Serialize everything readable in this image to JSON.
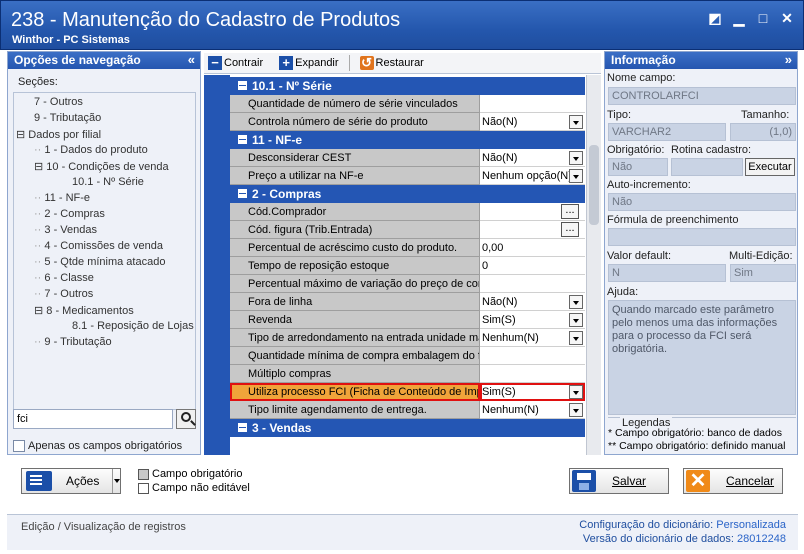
{
  "window": {
    "title": "238 - Manutenção do Cadastro de Produtos",
    "subtitle": "Winthor - PC Sistemas"
  },
  "nav": {
    "header": "Opções de navegação",
    "sections_label": "Seções:",
    "tree": [
      "7 - Outros",
      "9 - Tributação",
      "Dados por filial",
      "1 - Dados do produto",
      "10 - Condições de venda",
      "10.1 - Nº Série",
      "11 - NF-e",
      "2 - Compras",
      "3 - Vendas",
      "4 - Comissões de venda",
      "5 - Qtde mínima atacado",
      "6 - Classe",
      "7 - Outros",
      "8 - Medicamentos",
      "8.1 -  Reposição de Lojas",
      "9 - Tributação"
    ],
    "search_value": "fci",
    "only_required_label": "Apenas os campos obrigatórios"
  },
  "toolbar": {
    "collapse": "Contrair",
    "expand": "Expandir",
    "restore": "Restaurar"
  },
  "grid": {
    "rows": [
      {
        "type": "cat",
        "label": "10.1 - Nº Série"
      },
      {
        "type": "field",
        "label": "Quantidade de número de série vinculados",
        "value": ""
      },
      {
        "type": "field",
        "label": "Controla número de série do produto",
        "value": "Não(N)",
        "dd": true
      },
      {
        "type": "cat",
        "label": "11 - NF-e"
      },
      {
        "type": "field",
        "label": "Desconsiderar CEST",
        "value": "Não(N)",
        "dd": true
      },
      {
        "type": "field",
        "label": "Preço a utilizar na NF-e",
        "value": "Nenhum opção(N)",
        "dd": true
      },
      {
        "type": "cat",
        "label": "2 - Compras"
      },
      {
        "type": "field",
        "label": "Cód.Comprador",
        "value": "",
        "ell": true
      },
      {
        "type": "field",
        "label": "Cód. figura (Trib.Entrada)",
        "value": "",
        "ell": true
      },
      {
        "type": "field",
        "label": "Percentual de acréscimo custo do produto.",
        "value": "0,00"
      },
      {
        "type": "field",
        "label": "Tempo de reposição estoque",
        "value": "0"
      },
      {
        "type": "field",
        "label": "Percentual máximo de variação do preço de com",
        "value": ""
      },
      {
        "type": "field",
        "label": "Fora de linha",
        "value": "Não(N)",
        "dd": true
      },
      {
        "type": "field",
        "label": "Revenda",
        "value": "Sim(S)",
        "dd": true
      },
      {
        "type": "field",
        "label": "Tipo de arredondamento na entrada unidade ma",
        "value": "Nenhum(N)",
        "dd": true
      },
      {
        "type": "field",
        "label": "Quantidade mínima de compra embalagem do fo",
        "value": ""
      },
      {
        "type": "field",
        "label": "Múltiplo compras",
        "value": ""
      },
      {
        "type": "field",
        "label": "Utiliza processo FCI (Ficha de Conteúdo de Impo",
        "value": "Sim(S)",
        "dd": true,
        "hl": true
      },
      {
        "type": "field",
        "label": "Tipo limite agendamento de entrega.",
        "value": "Nenhum(N)",
        "dd": true
      },
      {
        "type": "cat",
        "label": "3 - Vendas"
      }
    ]
  },
  "info": {
    "header": "Informação",
    "field_name_label": "Nome campo:",
    "field_name_value": "CONTROLARFCI",
    "type_label": "Tipo:",
    "type_value": "VARCHAR2",
    "size_label": "Tamanho:",
    "size_value": "(1,0)",
    "required_label": "Obrigatório:",
    "required_value": "Não",
    "routine_label": "Rotina cadastro:",
    "execute_label": "Executar",
    "autoinc_label": "Auto-incremento:",
    "autoinc_value": "Não",
    "formula_label": "Fórmula de preenchimento",
    "default_label": "Valor default:",
    "default_value": "N",
    "multiedit_label": "Multi-Edição:",
    "multiedit_value": "Sim",
    "help_label": "Ajuda:",
    "help_text": "Quando marcado este parâmetro pelo menos uma das informações para o processo da FCI será obrigatória.",
    "legend_title": "Legendas",
    "legend_1": "* Campo obrigatório: banco de dados",
    "legend_2": "** Campo obrigatório: definido manual"
  },
  "actions": {
    "actions_label": "Ações",
    "required_field_label": "Campo obrigatório",
    "non_editable_label": "Campo não editável",
    "save_label": "Salvar",
    "cancel_label": "Cancelar"
  },
  "status": {
    "mode": "Edição / Visualização de registros",
    "dict_config_key": "Configuração do dicionário:",
    "dict_config_val": "Personalizada",
    "dict_version_key": "Versão do dicionário de dados:",
    "dict_version_val": "28012248"
  },
  "colors": {
    "title_bar": "#2457ad",
    "grid_category": "#2456b4",
    "highlight_border": "#e01010",
    "highlight_fill": "#f0a43a",
    "required_swatch": "#c8c8c8",
    "non_editable_swatch": "#ffffff"
  }
}
